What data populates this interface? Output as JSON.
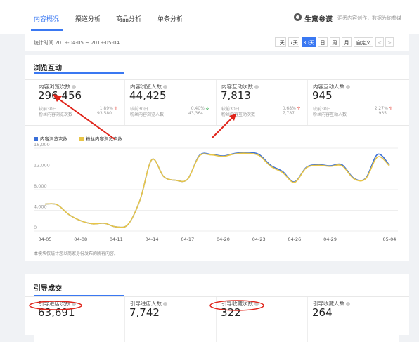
{
  "nav": {
    "tabs": [
      "内容概况",
      "渠道分析",
      "商品分析",
      "单条分析"
    ],
    "brand_name": "生意参谋",
    "brand_tagline": "洞悉内容创作，数据为你参谋"
  },
  "date_bar": {
    "label": "统计时间 2019-04-05 ~ 2019-05-04",
    "ranges": [
      "1天",
      "7天",
      "30天",
      "日",
      "周",
      "月",
      "自定义"
    ],
    "active_range": "30天",
    "prev": "<",
    "next": ">"
  },
  "browse": {
    "title": "浏览互动",
    "cards": [
      {
        "label": "内容浏览次数",
        "value": "296,456",
        "compare": "较前30日",
        "change": "1.89%",
        "trend": "up",
        "sub": "粉丝内容浏览次数",
        "sub_value": "93,580"
      },
      {
        "label": "内容浏览人数",
        "value": "44,425",
        "compare": "较前30日",
        "change": "0.40%",
        "trend": "down",
        "sub": "粉丝内容浏览人数",
        "sub_value": "43,364"
      },
      {
        "label": "内容互动次数",
        "value": "7,813",
        "compare": "较前30日",
        "change": "0.68%",
        "trend": "up",
        "sub": "粉丝内容互动次数",
        "sub_value": "7,787"
      },
      {
        "label": "内容互动人数",
        "value": "945",
        "compare": "较前30日",
        "change": "2.27%",
        "trend": "up",
        "sub": "粉丝内容互动人数",
        "sub_value": "935"
      }
    ],
    "footnote": "本模块仅统计您以商家身份发布的所有内容。"
  },
  "guide": {
    "title": "引导成交",
    "cards": [
      {
        "label": "引导进店次数",
        "value": "63,691"
      },
      {
        "label": "引导进店人数",
        "value": "7,742"
      },
      {
        "label": "引导收藏次数",
        "value": "322"
      },
      {
        "label": "引导收藏人数",
        "value": "264"
      }
    ]
  },
  "colors": {
    "accent": "#3a78f2",
    "series1": "#3a6fd8",
    "series2": "#e8c547",
    "annotation": "#e0251b",
    "up": "#e63a2e",
    "down": "#2eaa4a"
  },
  "chart_data": {
    "type": "line",
    "x": [
      "04-05",
      "04-06",
      "04-07",
      "04-08",
      "04-09",
      "04-10",
      "04-11",
      "04-12",
      "04-13",
      "04-14",
      "04-15",
      "04-16",
      "04-17",
      "04-18",
      "04-19",
      "04-20",
      "04-21",
      "04-22",
      "04-23",
      "04-24",
      "04-25",
      "04-26",
      "04-27",
      "04-28",
      "04-29",
      "04-30",
      "05-01",
      "05-02",
      "05-03",
      "05-04"
    ],
    "xticks": [
      "04-05",
      "04-08",
      "04-11",
      "04-14",
      "04-17",
      "04-20",
      "04-23",
      "04-26",
      "04-29",
      "05-04"
    ],
    "ylim": [
      0,
      16000
    ],
    "yticks": [
      "16,000",
      "12,000",
      "8,000",
      "4,000",
      "0"
    ],
    "series": [
      {
        "name": "内容浏览次数",
        "color": "#3a6fd8",
        "values": [
          5200,
          5100,
          3200,
          2000,
          1400,
          1500,
          800,
          1300,
          6000,
          13800,
          10500,
          9800,
          10000,
          14600,
          14800,
          14500,
          15000,
          15200,
          14800,
          12700,
          11500,
          9500,
          12300,
          12800,
          12600,
          12800,
          10200,
          10200,
          14800,
          12700
        ]
      },
      {
        "name": "粉丝内容浏览次数",
        "color": "#e8c547",
        "values": [
          5200,
          5100,
          3200,
          2000,
          1400,
          1500,
          800,
          1300,
          6000,
          13800,
          10500,
          9800,
          10000,
          14500,
          14700,
          14400,
          14900,
          15000,
          14600,
          12500,
          11300,
          9400,
          12200,
          12700,
          12500,
          12600,
          10100,
          10100,
          14300,
          12600
        ]
      }
    ]
  }
}
